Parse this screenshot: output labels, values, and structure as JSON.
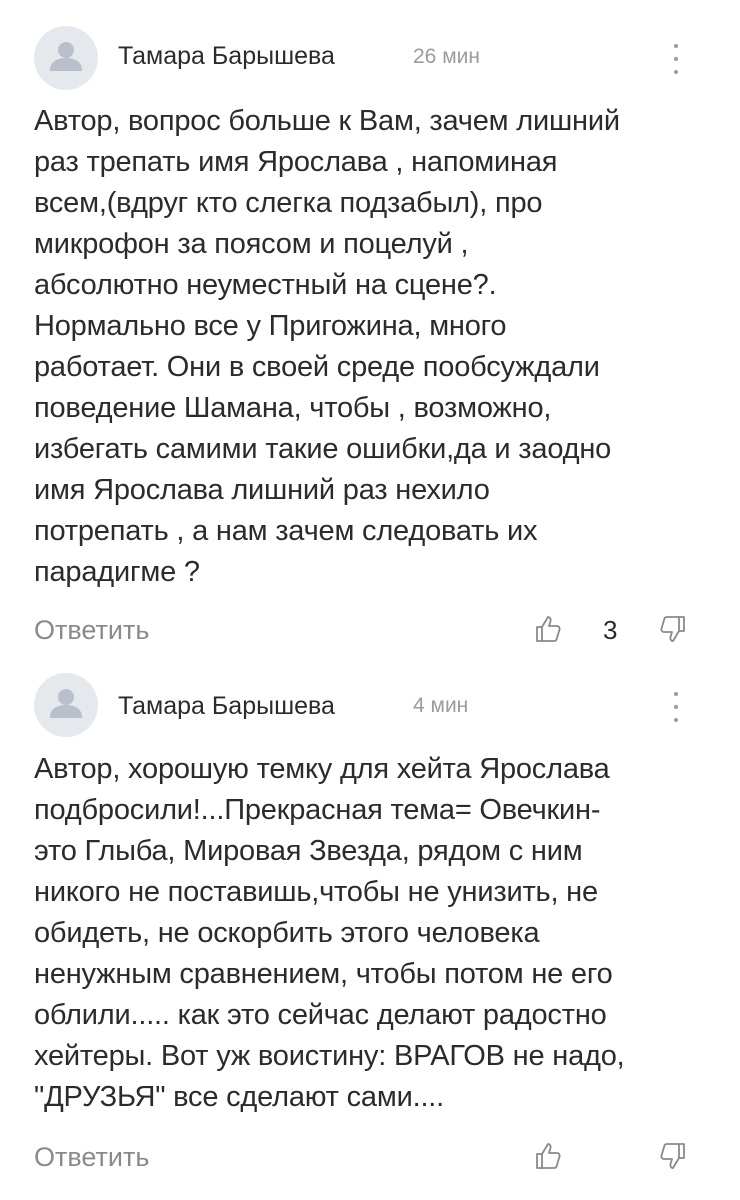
{
  "comments": [
    {
      "author": "Тамара Барышева",
      "time": "26 мин",
      "text": "Автор, вопрос больше к Вам, зачем лишний\nраз трепать имя Ярослава , напоминая\nвсем,(вдруг кто слегка подзабыл), про\nмикрофон за поясом и поцелуй ,\nабсолютно неуместный на сцене?.\nНормально все у Пригожина, много\nработает. Они в своей среде пообсуждали\nповедение Шамана, чтобы , возможно,\nизбегать самими такие ошибки,да и заодно\nимя Ярослава лишний раз нехило\nпотрепать , а нам зачем следовать их\nпарадигме ?",
      "reply_label": "Ответить",
      "likes": "3",
      "icons": {
        "avatar": "user-avatar-icon",
        "more": "more-vertical-icon",
        "like": "thumbs-up-icon",
        "dislike": "thumbs-down-icon"
      }
    },
    {
      "author": "Тамара Барышева",
      "time": "4 мин",
      "text": "Автор, хорошую темку для хейта Ярослава\nподбросили!...Прекрасная тема= Овечкин-\nэто Глыба, Мировая Звезда, рядом с ним\nникого не поставишь,чтобы не унизить, не\nобидеть, не оскорбить этого человека\nненужным сравнением, чтобы потом не его\nоблили..... как это сейчас делают радостно\nхейтеры. Вот уж воистину: ВРАГОВ не надо,\n\"ДРУЗЬЯ\" все сделают сами....",
      "reply_label": "Ответить",
      "likes": "",
      "icons": {
        "avatar": "user-avatar-icon",
        "more": "more-vertical-icon",
        "like": "thumbs-up-icon",
        "dislike": "thumbs-down-icon"
      }
    }
  ],
  "colors": {
    "text": "#2b2b2b",
    "muted": "#9b9b9b",
    "avatar_bg": "#e5e8ed",
    "avatar_fg": "#b9c0cb"
  }
}
